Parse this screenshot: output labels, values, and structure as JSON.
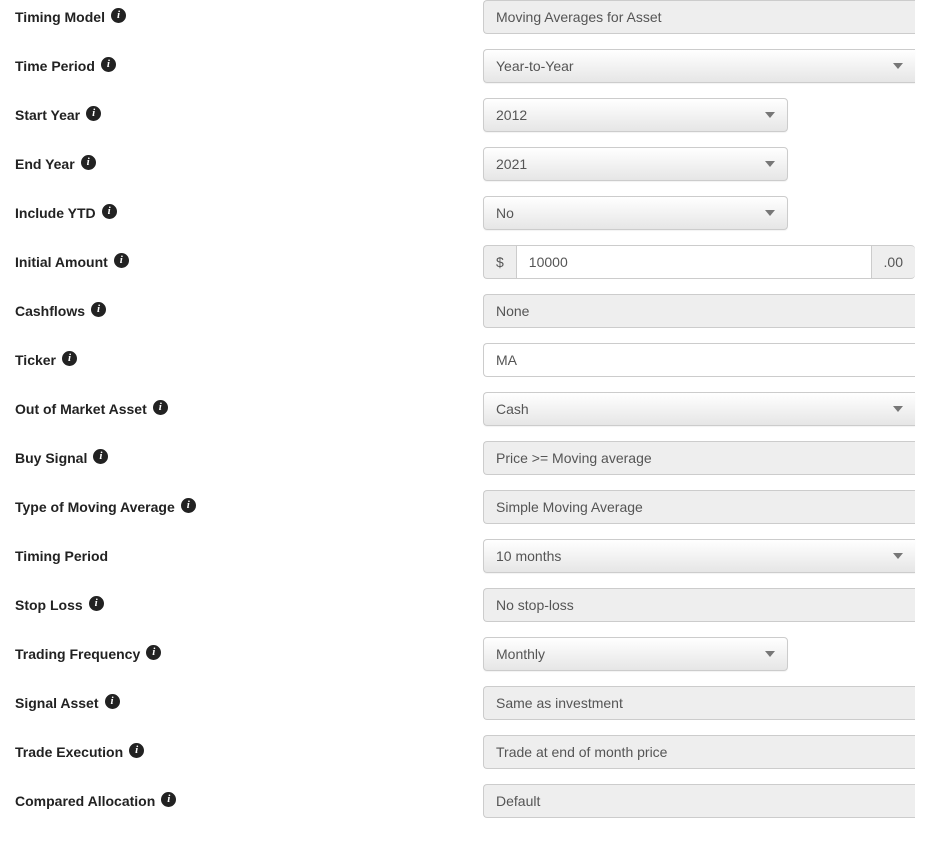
{
  "labels": {
    "timing_model": "Timing Model",
    "time_period": "Time Period",
    "start_year": "Start Year",
    "end_year": "End Year",
    "include_ytd": "Include YTD",
    "initial_amount": "Initial Amount",
    "cashflows": "Cashflows",
    "ticker": "Ticker",
    "out_of_market_asset": "Out of Market Asset",
    "buy_signal": "Buy Signal",
    "type_ma": "Type of Moving Average",
    "timing_period": "Timing Period",
    "stop_loss": "Stop Loss",
    "trading_frequency": "Trading Frequency",
    "signal_asset": "Signal Asset",
    "trade_execution": "Trade Execution",
    "compared_allocation": "Compared Allocation"
  },
  "values": {
    "timing_model": "Moving Averages for Asset",
    "time_period": "Year-to-Year",
    "start_year": "2012",
    "end_year": "2021",
    "include_ytd": "No",
    "initial_amount_prefix": "$",
    "initial_amount": "10000",
    "initial_amount_suffix": ".00",
    "cashflows": "None",
    "ticker": "MA",
    "out_of_market_asset": "Cash",
    "buy_signal": "Price >= Moving average",
    "type_ma": "Simple Moving Average",
    "timing_period": "10 months",
    "stop_loss": "No stop-loss",
    "trading_frequency": "Monthly",
    "signal_asset": "Same as investment",
    "trade_execution": "Trade at end of month price",
    "compared_allocation": "Default"
  },
  "icons": {
    "info_glyph": "i"
  }
}
